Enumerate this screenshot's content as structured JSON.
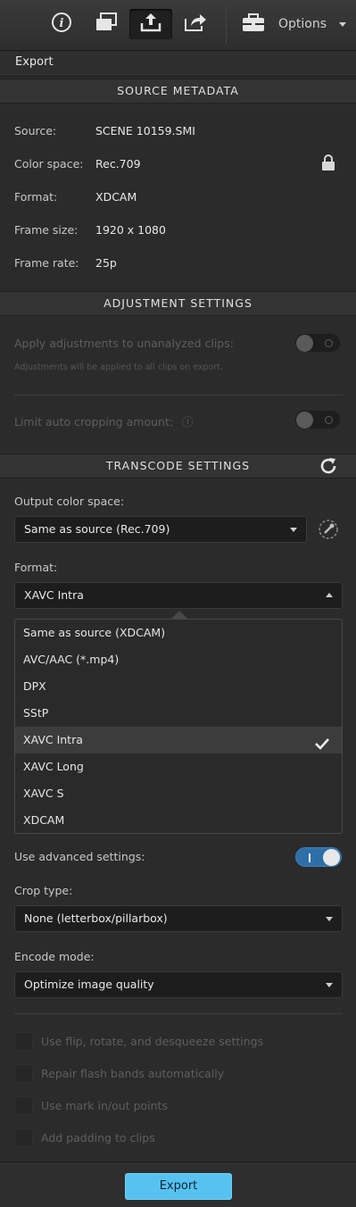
{
  "toolbar": {
    "buttons": [
      {
        "icon": "info-icon"
      },
      {
        "icon": "clips-icon"
      },
      {
        "icon": "export-tray-icon"
      },
      {
        "icon": "share-icon"
      }
    ],
    "options_icon": "briefcase-icon",
    "options_label": "Options"
  },
  "panel": {
    "title": "Export"
  },
  "source_metadata": {
    "heading": "SOURCE METADATA",
    "rows": [
      {
        "label": "Source:",
        "value": "SCENE 10159.SMI"
      },
      {
        "label": "Color space:",
        "value": "Rec.709"
      },
      {
        "label": "Format:",
        "value": "XDCAM"
      },
      {
        "label": "Frame size:",
        "value": "1920 x 1080"
      },
      {
        "label": "Frame rate:",
        "value": "25p"
      }
    ]
  },
  "adjustment_settings": {
    "heading": "ADJUSTMENT SETTINGS",
    "apply_label": "Apply adjustments to unanalyzed clips:",
    "apply_hint": "Adjustments will be applied to all clips on export.",
    "apply_on": false,
    "limit_label": "Limit auto cropping amount:",
    "limit_info": "ⓘ",
    "limit_on": false
  },
  "transcode_settings": {
    "heading": "TRANSCODE SETTINGS",
    "output_color_space_label": "Output color space:",
    "output_color_space_value": "Same as source (Rec.709)",
    "format_label": "Format:",
    "format_value": "XAVC Intra",
    "format_options": [
      "Same as source (XDCAM)",
      "AVC/AAC (*.mp4)",
      "DPX",
      "SStP",
      "XAVC Intra",
      "XAVC Long",
      "XAVC S",
      "XDCAM"
    ],
    "format_selected": "XAVC Intra",
    "advanced_label": "Use advanced settings:",
    "advanced_on": true,
    "crop_type_label": "Crop type:",
    "crop_type_value": "None (letterbox/pillarbox)",
    "encode_mode_label": "Encode mode:",
    "encode_mode_value": "Optimize image quality",
    "checkboxes": [
      "Use flip, rotate, and desqueeze settings",
      "Repair flash bands automatically",
      "Use mark in/out points",
      "Add padding to clips"
    ]
  },
  "footer": {
    "export_label": "Export"
  },
  "colors": {
    "accent": "#57c2f0",
    "toggle_on": "#2f6fa8",
    "background": "#2b2b2b"
  }
}
